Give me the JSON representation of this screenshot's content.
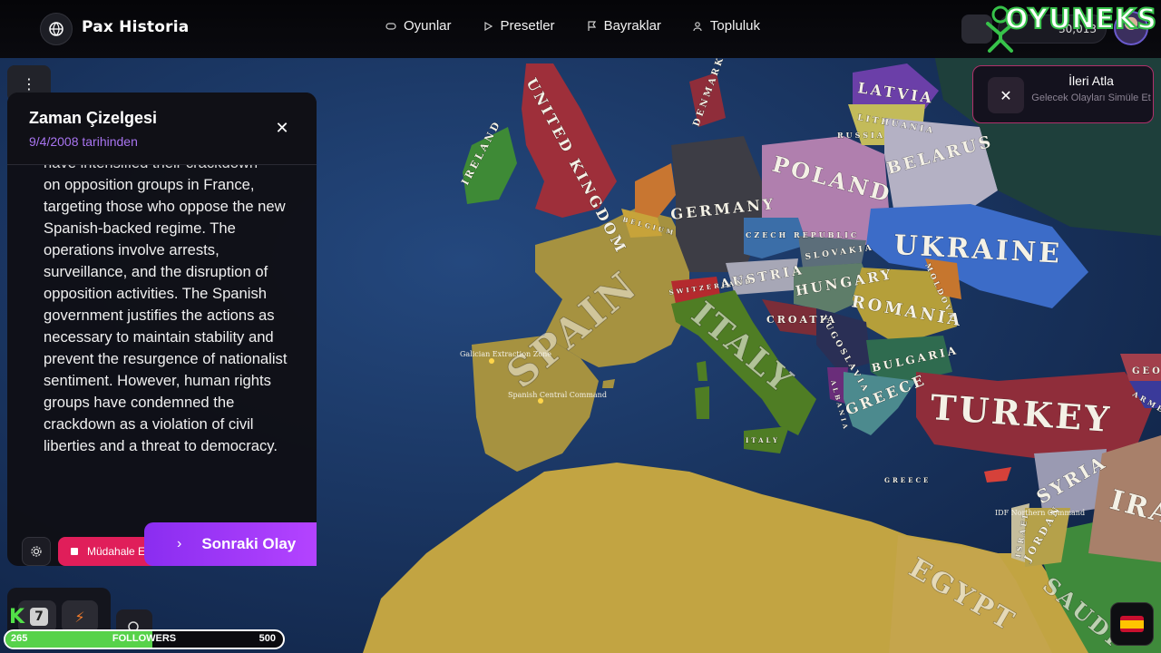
{
  "app": {
    "name": "Pax Historia"
  },
  "nav": [
    {
      "label": "Oyunlar",
      "icon": "gamepad-icon"
    },
    {
      "label": "Presetler",
      "icon": "play-icon"
    },
    {
      "label": "Bayraklar",
      "icon": "flag-icon"
    },
    {
      "label": "Topluluk",
      "icon": "people-icon"
    }
  ],
  "account": {
    "credits": "30,013"
  },
  "watermark": {
    "text": "OYUNEKS"
  },
  "skip": {
    "title": "İleri Atla",
    "subtitle": "Gelecek Olayları Simüle Et"
  },
  "timeline": {
    "title": "Zaman Çizelgesi",
    "date": "9/4/2008 tarihinden",
    "partial_line": "have intensified their crackdown",
    "text": "on opposition groups in France, targeting those who oppose the new Spanish-backed regime. The operations involve arrests, surveillance, and the disruption of opposition activities. The Spanish government justifies the actions as necessary to maintain stability and prevent the resurgence of nationalist sentiment. However, human rights groups have condemned the crackdown as a violation of civil liberties and a threat to democracy."
  },
  "actions": {
    "intervene": "Müdahale Et",
    "next_event": "Sonraki Olay"
  },
  "followers": {
    "current": "265",
    "label": "FOLLOWERS",
    "goal": "500",
    "progress": 0.53
  },
  "map": {
    "countries": [
      "UNITED KINGDOM",
      "IRELAND",
      "DENMARK",
      "LATVIA",
      "LITHUANIA",
      "RUSSIA",
      "BELARUS",
      "POLAND",
      "GERMANY",
      "CZECH REPUBLIC",
      "SLOVAKIA",
      "UKRAINE",
      "MOLDOVA",
      "AUSTRIA",
      "HUNGARY",
      "ROMANIA",
      "SWITZERLAND",
      "BELGIUM",
      "CROATIA",
      "YUGOSLAVIA",
      "BULGARIA",
      "SPAIN",
      "ITALY",
      "GREECE",
      "ALBANIA",
      "TURKEY",
      "SYRIA",
      "IRAQ",
      "JORDAN",
      "ISRAEL",
      "EGYPT",
      "SAUDI",
      "GEORGIA",
      "ARMENIA",
      "ITALY",
      "GREECE"
    ],
    "markers": [
      "Galician Extraction Zone",
      "Spanish Central Command",
      "IDF Northern Command"
    ],
    "colors": {
      "sea": "#1b3560",
      "land": "#c9a94f",
      "spain": "#a08e3a",
      "uk": "#9e2f3a",
      "germany": "#3d3d45",
      "italy": "#4f7d24",
      "turkey": "#8f2d3a",
      "ukraine": "#3c6cc8",
      "poland": "#b07fae"
    }
  }
}
